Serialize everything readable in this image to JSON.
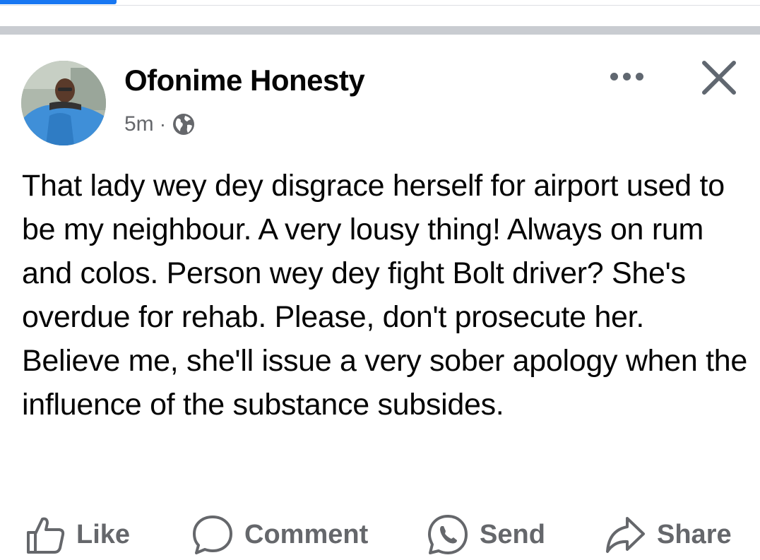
{
  "post": {
    "author_name": "Ofonime Honesty",
    "timestamp": "5m",
    "separator": "·",
    "audience_icon": "globe-icon",
    "text": "That lady wey dey disgrace herself for airport used to be my neighbour. A very lousy thing! Always on rum and colos. Person wey dey fight Bolt driver? She's overdue for rehab. Please, don't prosecute her. Believe me, she'll issue a very sober apology when the influence of the substance subsides."
  },
  "header": {
    "more_icon": "more-horizontal-icon",
    "close_icon": "close-icon"
  },
  "actions": {
    "like_label": "Like",
    "comment_label": "Comment",
    "send_label": "Send",
    "share_label": "Share"
  },
  "colors": {
    "accent": "#1877f2",
    "secondary_text": "#65676b",
    "primary_text": "#050505"
  }
}
